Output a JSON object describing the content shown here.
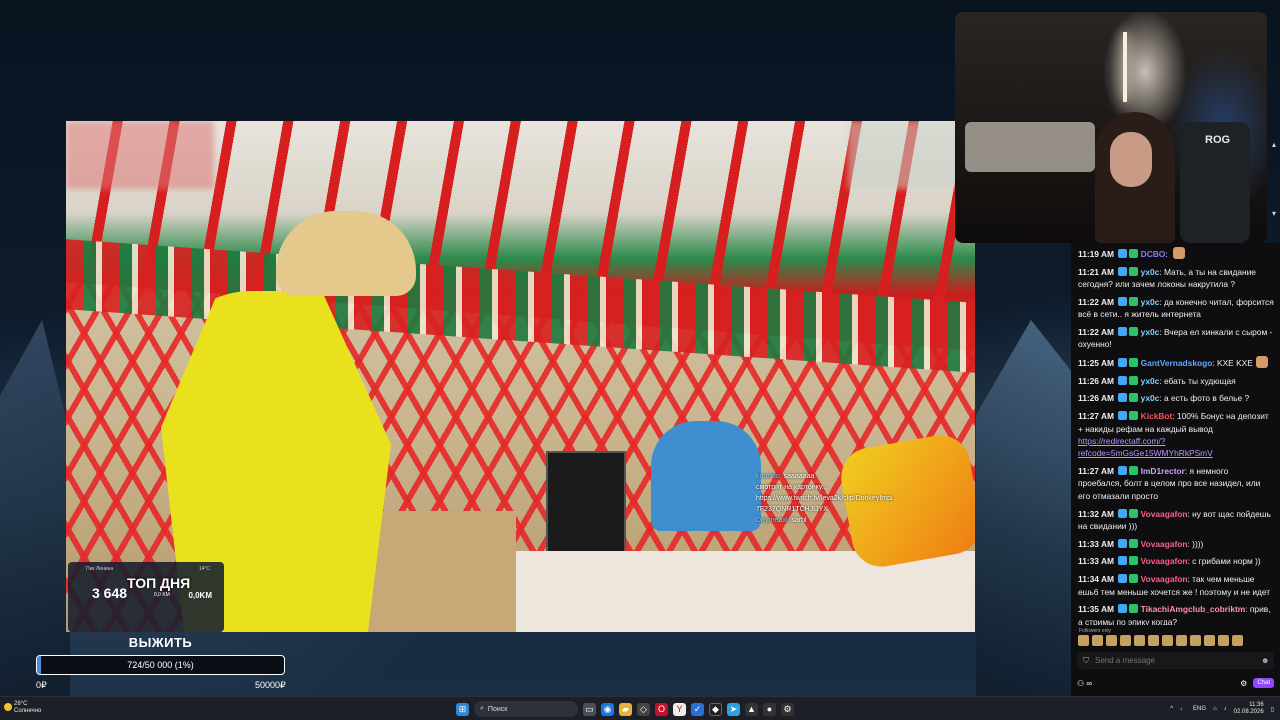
{
  "stream_overlay": {
    "stats": {
      "location": "Пик Ленина",
      "temperature": "14°C",
      "elevation": "3 648",
      "altitude_small": "0,0 KM",
      "distance": "0,0KM"
    },
    "top_day_label": "ТОП ДНЯ",
    "video_chat": [
      {
        "nick": "kuoskio:",
        "text": "saaaaaaa"
      },
      {
        "nick": "",
        "text": "смотрит на картонку..."
      },
      {
        "nick": "",
        "text": "https://www.twitch.tv/leva2k/clip/DonkeyImpl..."
      },
      {
        "nick": "",
        "text": "7F237QNR1TCHJIJYX"
      },
      {
        "nick": "Dayoreaxl:",
        "text": "sarbl"
      }
    ]
  },
  "goal": {
    "title": "ВЫЖИТЬ",
    "progress_text": "724/50 000 (1%)",
    "progress_fraction": 0.0145,
    "min_label": "0₽",
    "max_label": "50000₽",
    "fill_color": "#4d8fd6"
  },
  "webcam": {
    "brand_text": "ROG"
  },
  "chat": {
    "messages": [
      {
        "time": "11:19 AM",
        "nick": "DCBO",
        "color": "#8a7bff",
        "text": "",
        "emote": true,
        "link": ""
      },
      {
        "time": "11:21 AM",
        "nick": "yx0c",
        "color": "#7fd1ff",
        "text": "Мать, а ты на свидание сегодня? или зачем локоны накрутила ?",
        "emote": false,
        "link": ""
      },
      {
        "time": "11:22 AM",
        "nick": "yx0c",
        "color": "#7fd1ff",
        "text": "да конечно читал, форсится всё в сети.. я житель интернета",
        "emote": false,
        "link": ""
      },
      {
        "time": "11:22 AM",
        "nick": "yx0c",
        "color": "#7fd1ff",
        "text": "Вчера ел хинкали с сыром - охуенно!",
        "emote": false,
        "link": ""
      },
      {
        "time": "11:25 AM",
        "nick": "GantVernadskogo",
        "color": "#5fa8ff",
        "text": "KXE KXE",
        "emote": true,
        "link": ""
      },
      {
        "time": "11:26 AM",
        "nick": "yx0c",
        "color": "#7fd1ff",
        "text": "ебать ты худющая",
        "emote": false,
        "link": ""
      },
      {
        "time": "11:26 AM",
        "nick": "yx0c",
        "color": "#7fd1ff",
        "text": "а есть фото в белье ?",
        "emote": false,
        "link": ""
      },
      {
        "time": "11:27 AM",
        "nick": "KickBot",
        "color": "#ff4f4f",
        "text": "100% Бонус на депозит + накиды рефам на каждый вывод",
        "emote": false,
        "link": "https://redirectaff.com/?refcode=5mGsGe15WMYhRkPSmV"
      },
      {
        "time": "11:27 AM",
        "nick": "ImD1rector",
        "color": "#c9a6ff",
        "text": "я немного проебался, болт в целом про все назидел, или его отмазали просто",
        "emote": false,
        "link": ""
      },
      {
        "time": "11:32 AM",
        "nick": "Vovaagafon",
        "color": "#ff5e8a",
        "text": "ну вот щас пойдешь на свидании )))",
        "emote": false,
        "link": ""
      },
      {
        "time": "11:33 AM",
        "nick": "Vovaagafon",
        "color": "#ff5e8a",
        "text": "))))",
        "emote": false,
        "link": ""
      },
      {
        "time": "11:33 AM",
        "nick": "Vovaagafon",
        "color": "#ff5e8a",
        "text": "с грибами норм ))",
        "emote": false,
        "link": ""
      },
      {
        "time": "11:34 AM",
        "nick": "Vovaagafon",
        "color": "#ff5e8a",
        "text": "так чем меньше ешь6 тем меньше хочется же ! поэтому и не идет",
        "emote": false,
        "link": ""
      },
      {
        "time": "11:35 AM",
        "nick": "TikachiAmgclub_cobriktm",
        "color": "#ff8fb0",
        "text": "прив, а стримы по эпику когда?",
        "emote": false,
        "link": ""
      }
    ],
    "followers_only": "Followers only",
    "input_placeholder": "Send a message",
    "chat_button": "Chat"
  },
  "taskbar": {
    "weather_temp": "28°C",
    "weather_desc": "Солнечно",
    "search_placeholder": "Поиск",
    "language": "ENG",
    "time": "11:36",
    "date": "02.08.2026"
  }
}
